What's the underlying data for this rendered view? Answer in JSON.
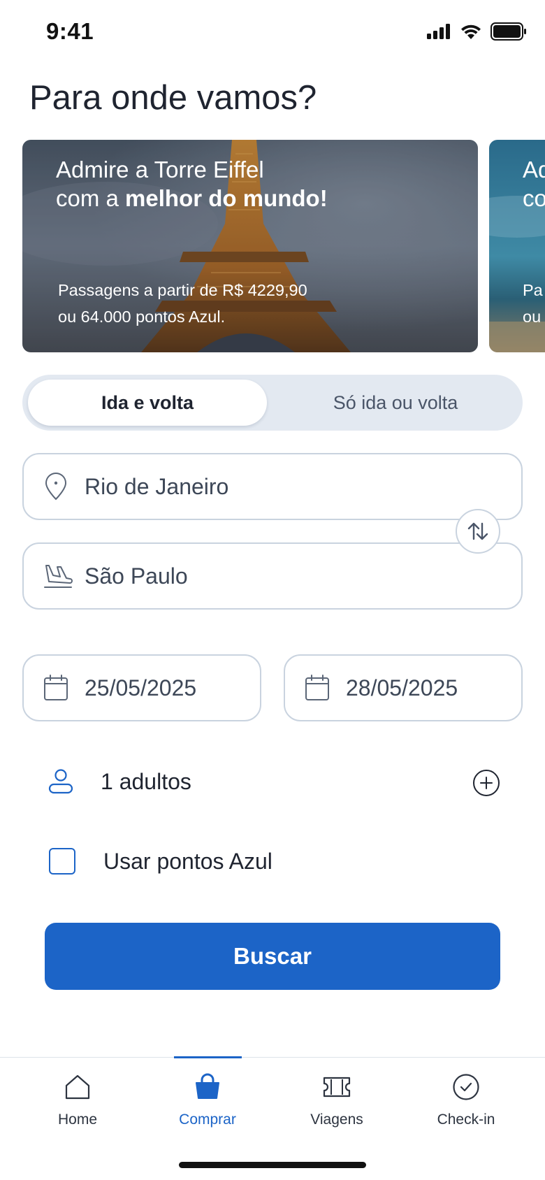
{
  "status_bar": {
    "time": "9:41"
  },
  "page_title": "Para onde vamos?",
  "promos": [
    {
      "headline_pre": "Admire a Torre Eiffel",
      "headline_line2_pre": "com a ",
      "headline_bold": "melhor do mundo!",
      "sub_line1": "Passagens a partir de R$ 4229,90",
      "sub_line2": "ou 64.000 pontos Azul."
    },
    {
      "headline_pre": "Ad",
      "headline_line2_pre": "co",
      "sub_line1": "Pa",
      "sub_line2": "ou"
    }
  ],
  "trip_type": {
    "options": [
      "Ida e volta",
      "Só ida ou volta"
    ],
    "selected": "Ida e volta"
  },
  "origin": "Rio de Janeiro",
  "destination": "São Paulo",
  "dates": {
    "departure": "25/05/2025",
    "return": "28/05/2025"
  },
  "passengers": "1 adultos",
  "use_points_label": "Usar pontos Azul",
  "search_label": "Buscar",
  "tabs": [
    {
      "label": "Home",
      "icon": "home-icon"
    },
    {
      "label": "Comprar",
      "icon": "shopping-bag-icon"
    },
    {
      "label": "Viagens",
      "icon": "ticket-icon"
    },
    {
      "label": "Check-in",
      "icon": "check-circle-icon"
    }
  ],
  "active_tab": "Comprar",
  "colors": {
    "primary": "#1c64c7",
    "border": "#c9d3df",
    "toggle_bg": "#e3e9f1"
  }
}
